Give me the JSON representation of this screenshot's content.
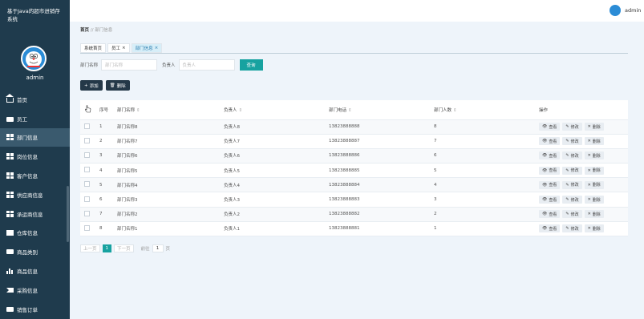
{
  "sidebar": {
    "title": "基于Java的超市进销存系统",
    "username": "admin",
    "items": [
      {
        "label": "首页",
        "icon": "home-icon"
      },
      {
        "label": "员工",
        "icon": "briefcase-icon"
      },
      {
        "label": "部门信息",
        "icon": "grid-icon",
        "active": true
      },
      {
        "label": "岗位信息",
        "icon": "grid-icon"
      },
      {
        "label": "客户信息",
        "icon": "grid-icon"
      },
      {
        "label": "供应商信息",
        "icon": "grid-icon"
      },
      {
        "label": "承运商信息",
        "icon": "grid-icon"
      },
      {
        "label": "仓库信息",
        "icon": "box-icon"
      },
      {
        "label": "商品类别",
        "icon": "chat-icon"
      },
      {
        "label": "商品信息",
        "icon": "bar-chart-icon"
      },
      {
        "label": "采购信息",
        "icon": "exchange-icon"
      },
      {
        "label": "销售订单",
        "icon": "monitor-icon"
      }
    ]
  },
  "topbar": {
    "username": "admin"
  },
  "breadcrumb": {
    "home": "首页",
    "sep": "//",
    "current": "部门信息"
  },
  "tabs": [
    {
      "label": "系统首页",
      "closable": false
    },
    {
      "label": "员工",
      "closable": true
    },
    {
      "label": "部门信息",
      "closable": true,
      "active": true
    }
  ],
  "search": {
    "name_label": "部门名称",
    "name_placeholder": "部门名称",
    "head_label": "负责人",
    "head_placeholder": "负责人",
    "button": "查询"
  },
  "actions": {
    "add": "添加",
    "delete": "删除"
  },
  "table": {
    "headers": {
      "index": "序号",
      "name": "部门名称",
      "head": "负责人",
      "phone": "部门电话",
      "count": "部门人数",
      "ops": "操作"
    },
    "ops": {
      "view": "查看",
      "edit": "修改",
      "delete": "删除"
    },
    "rows": [
      {
        "index": "1",
        "name": "部门名称8",
        "head": "负责人8",
        "phone": "13823888888",
        "count": "8"
      },
      {
        "index": "2",
        "name": "部门名称7",
        "head": "负责人7",
        "phone": "13823888887",
        "count": "7"
      },
      {
        "index": "3",
        "name": "部门名称6",
        "head": "负责人6",
        "phone": "13823888886",
        "count": "6"
      },
      {
        "index": "4",
        "name": "部门名称5",
        "head": "负责人5",
        "phone": "13823888885",
        "count": "5"
      },
      {
        "index": "5",
        "name": "部门名称4",
        "head": "负责人4",
        "phone": "13823888884",
        "count": "4"
      },
      {
        "index": "6",
        "name": "部门名称3",
        "head": "负责人3",
        "phone": "13823888883",
        "count": "3"
      },
      {
        "index": "7",
        "name": "部门名称2",
        "head": "负责人2",
        "phone": "13823888882",
        "count": "2"
      },
      {
        "index": "8",
        "name": "部门名称1",
        "head": "负责人1",
        "phone": "13823888881",
        "count": "1"
      }
    ]
  },
  "pager": {
    "prev": "上一页",
    "current": "1",
    "next": "下一页",
    "goto": "前往",
    "page_value": "1",
    "unit": "页"
  },
  "colors": {
    "sidebar": "#1f3b4d",
    "accent": "#17a2a0",
    "active_tab": "#d7eef8"
  }
}
